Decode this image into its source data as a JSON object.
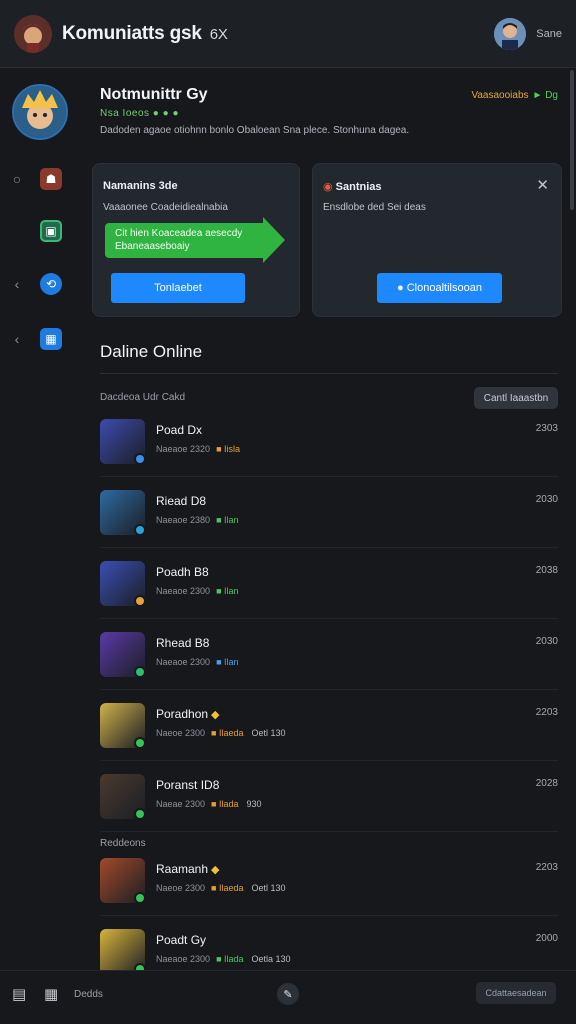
{
  "header": {
    "title": "Komuniatts gsk",
    "title_suffix": "6X",
    "user_name": "Sane"
  },
  "profile": {
    "name": "Notmunittr Gy",
    "subtitle": "Nsa Ioeos ● ● ●",
    "status_label": "Vaasaooiabs",
    "status_value": "► Dg",
    "description": "Dadoden agaoe otiohnn bonlo Obaloean Sna plece. Stonhuna dagea."
  },
  "cards": {
    "left": {
      "title": "Namanins 3de",
      "description": "Vaaaonee Coadeidiealnabia",
      "callout": "Cit hien Koaceadea aesecdy Ebaneaaseboaiy",
      "button": "Tonlaebet"
    },
    "right": {
      "title": "Santnias",
      "description": "Ensdlobe ded Sei deas",
      "button": "● Clonoaltilsooan"
    }
  },
  "online": {
    "title": "Daline Online",
    "subheader": "Dacdeoa Udr Cakd",
    "filter_button": "Cantl Iaaastbn"
  },
  "players": [
    {
      "name": "Poad Dx",
      "tag": "",
      "meta_a": "Naeaoe 2320",
      "dot": "■ Iisla",
      "dot_color": "orange",
      "extra": "",
      "time": "2303",
      "thumb": "#3d4bb0",
      "badge": "#3b8ef0"
    },
    {
      "name": "Riead D8",
      "tag": "",
      "meta_a": "Naeaoe 2380",
      "dot": "■ Ilan",
      "dot_color": "green",
      "extra": "",
      "time": "2030",
      "thumb": "#2f6aa3",
      "badge": "#2aa1e0"
    },
    {
      "name": "Poadh B8",
      "tag": "",
      "meta_a": "Naeaoe 2300",
      "dot": "■ Ilan",
      "dot_color": "green",
      "extra": "",
      "time": "2038",
      "thumb": "#3a4fb5",
      "badge": "#e8a23a"
    },
    {
      "name": "Rhead B8",
      "tag": "",
      "meta_a": "Naeaoe 2300",
      "dot": "■ Ilan",
      "dot_color": "blue",
      "extra": "",
      "time": "2030",
      "thumb": "#5a3aa8",
      "badge": "#2cbf6e"
    },
    {
      "name": "Poradhon",
      "tag": "◆",
      "meta_a": "Naeoe 2300",
      "dot": "■ Ilaeda",
      "dot_color": "orange",
      "extra": "Oetl 130",
      "time": "2203",
      "thumb": "#d1b24a",
      "badge": "#36c456"
    },
    {
      "name": "Poranst ID8",
      "tag": "",
      "meta_a": "Naeae 2300",
      "dot": "■ Ilada",
      "dot_color": "orange",
      "extra": "930",
      "time": "2028",
      "thumb": "#4a3a30",
      "badge": "#36c456"
    }
  ],
  "group_label": "Reddeons",
  "players_group2": [
    {
      "name": "Raamanh",
      "tag": "◆",
      "meta_a": "Naeoe 2300",
      "dot": "■ Ilaeda",
      "dot_color": "orange",
      "extra": "Oetl 130",
      "time": "2203",
      "thumb": "#a34a2a",
      "badge": "#36c456"
    },
    {
      "name": "Poadt Gy",
      "tag": "",
      "meta_a": "Naeaoe 2300",
      "dot": "■ Ilada",
      "dot_color": "green",
      "extra": "Oetla 130",
      "time": "2000",
      "thumb": "#d8b43a",
      "badge": "#36c456"
    }
  ],
  "bottom": {
    "label": "Dedds",
    "right_button": "Cdattaesadean"
  },
  "colors": {
    "accent": "#1e88ff",
    "online_green": "#2fb341",
    "status_orange": "#e2a93b"
  }
}
